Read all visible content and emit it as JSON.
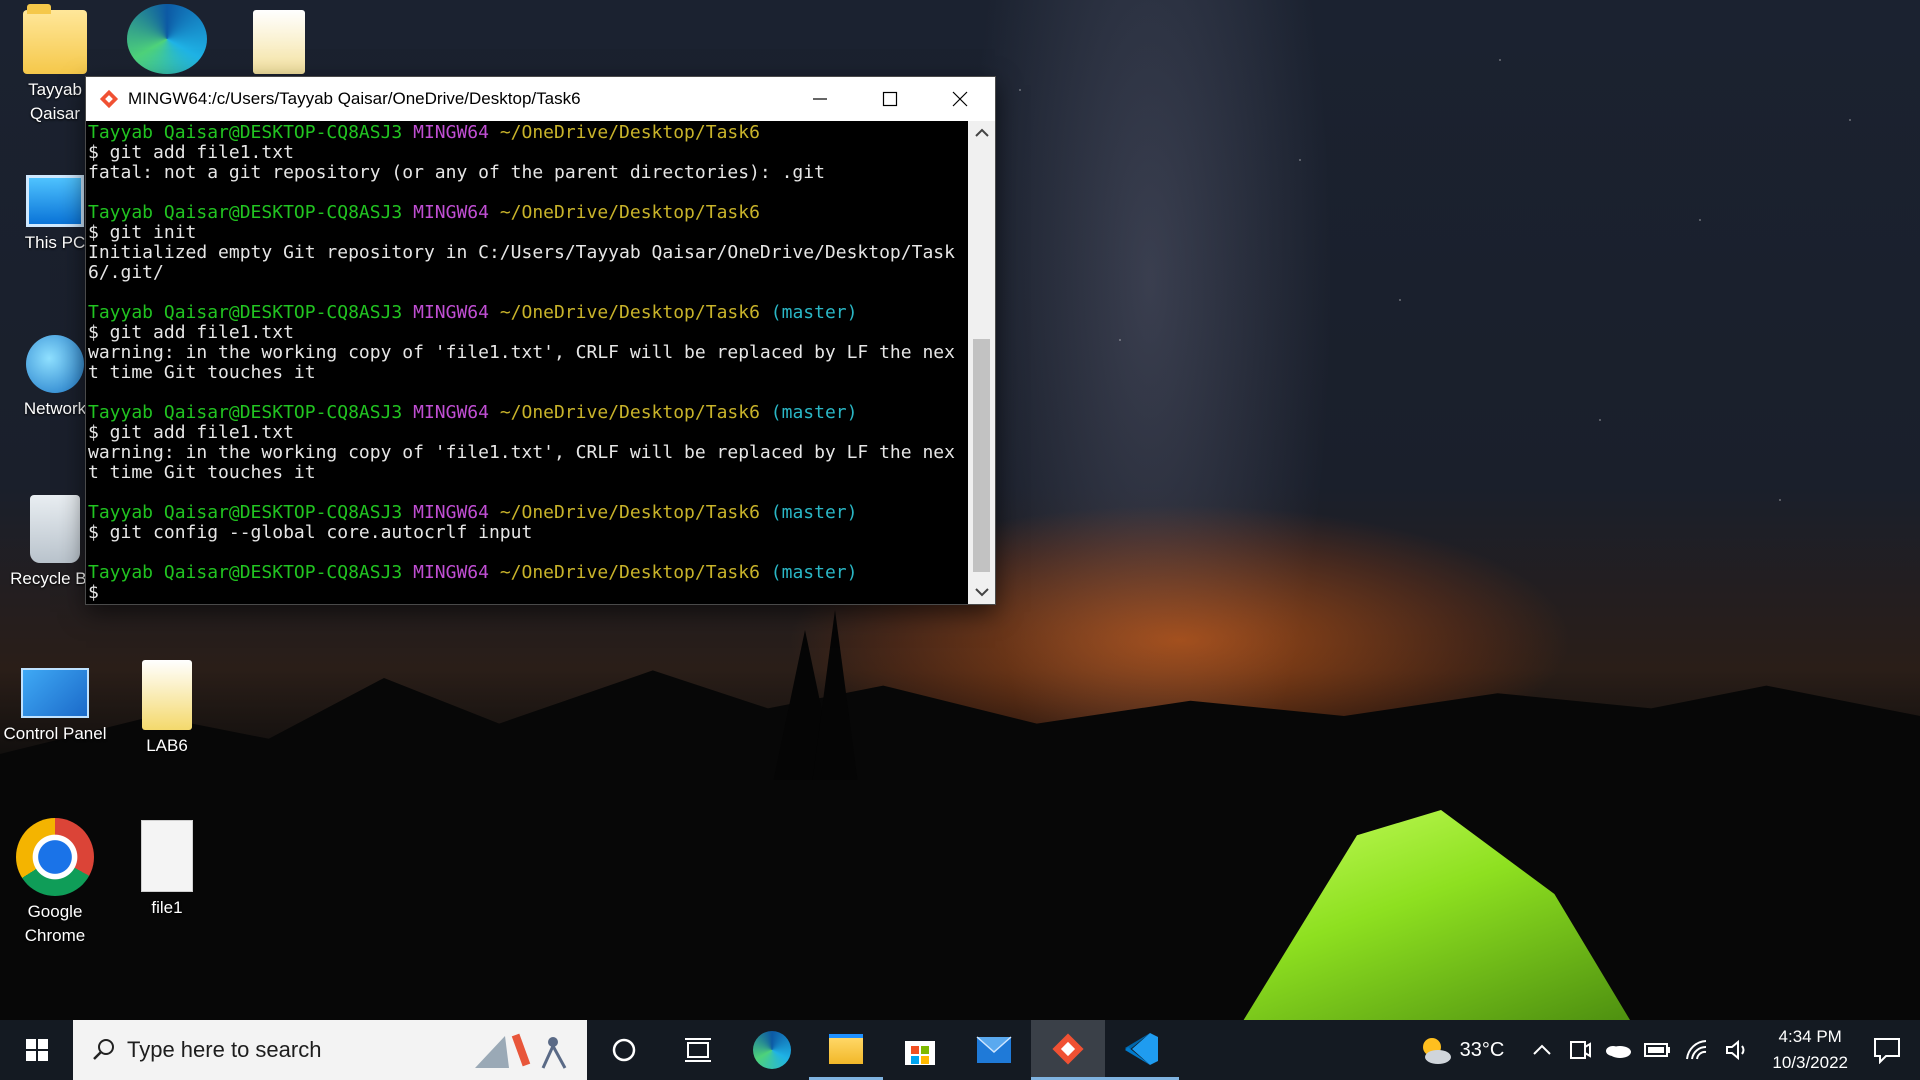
{
  "desktop": {
    "icons": [
      {
        "label": "Tayyab Qaisar",
        "icon": "user-folder-icon"
      },
      {
        "label": "This PC",
        "icon": "computer-icon"
      },
      {
        "label": "Network",
        "icon": "network-icon"
      },
      {
        "label": "Recycle Bin",
        "icon": "recycle-bin-icon"
      },
      {
        "label": "Control Panel",
        "icon": "control-panel-icon"
      },
      {
        "label": "LAB6",
        "icon": "folder-icon"
      },
      {
        "label": "Google Chrome",
        "icon": "chrome-icon"
      },
      {
        "label": "file1",
        "icon": "text-file-icon"
      }
    ]
  },
  "terminal": {
    "title": "MINGW64:/c/Users/Tayyab Qaisar/OneDrive/Desktop/Task6",
    "prompt_user": "Tayyab Qaisar@DESKTOP-CQ8ASJ3",
    "prompt_env": "MINGW64",
    "prompt_path": "~/OneDrive/Desktop/Task6",
    "branch": "(master)",
    "lines": {
      "cmd1": "$ git add file1.txt",
      "out1": "fatal: not a git repository (or any of the parent directories): .git",
      "cmd2": "$ git init",
      "out2a": "Initialized empty Git repository in C:/Users/Tayyab Qaisar/OneDrive/Desktop/Task",
      "out2b": "6/.git/",
      "cmd3": "$ git add file1.txt",
      "out3a": "warning: in the working copy of 'file1.txt', CRLF will be replaced by LF the nex",
      "out3b": "t time Git touches it",
      "cmd4": "$ git add file1.txt",
      "out4a": "warning: in the working copy of 'file1.txt', CRLF will be replaced by LF the nex",
      "out4b": "t time Git touches it",
      "cmd5": "$ git config --global core.autocrlf input",
      "cmd6": "$"
    }
  },
  "taskbar": {
    "search_placeholder": "Type here to search",
    "apps": [
      "cortana-icon",
      "task-view-icon",
      "edge-icon",
      "file-explorer-icon",
      "store-icon",
      "mail-icon",
      "git-bash-icon",
      "vscode-icon"
    ],
    "weather": "33°C",
    "time": "4:34 PM",
    "date": "10/3/2022"
  }
}
